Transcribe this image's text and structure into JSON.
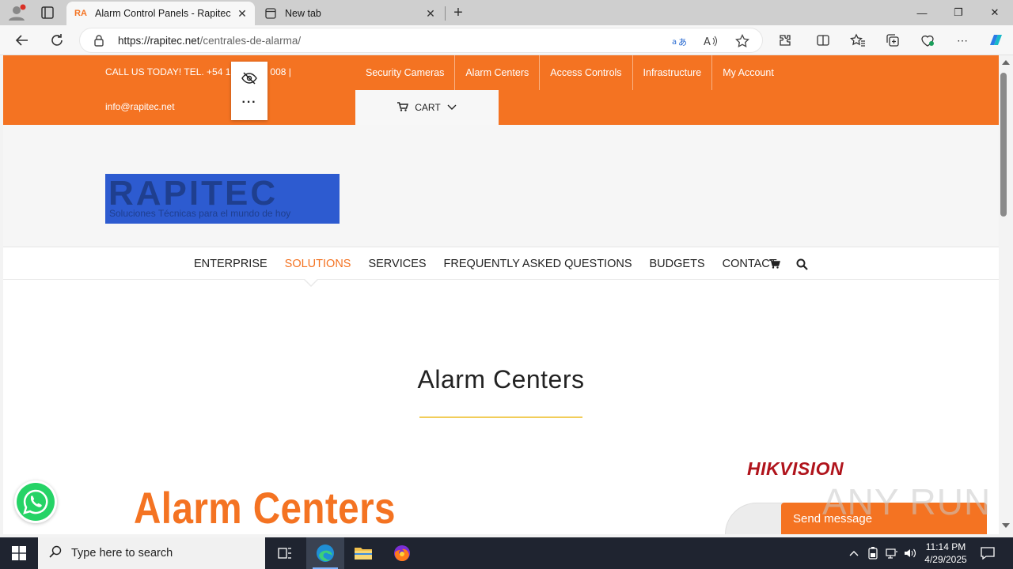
{
  "browser": {
    "tabs": [
      {
        "title": "Alarm Control Panels - Rapitec",
        "favicon_text": "RA",
        "active": true
      },
      {
        "title": "New tab",
        "active": false
      }
    ],
    "url_host": "https://rapitec.net",
    "url_path": "/centrales-de-alarma/"
  },
  "site": {
    "topbar": {
      "contact_left": "CALL US TODAY! TEL. +54 1",
      "contact_right": "008  |",
      "email": "info@rapitec.net",
      "nav": [
        "Security Cameras",
        "Alarm Centers",
        "Access Controls",
        "Infrastructure",
        "My Account"
      ],
      "cart_label": "CART"
    },
    "logo": {
      "brand": "RAPITEC",
      "tagline": "Soluciones Técnicas para el mundo de hoy"
    },
    "main_nav": [
      "ENTERPRISE",
      "SOLUTIONS",
      "SERVICES",
      "FREQUENTLY ASKED QUESTIONS",
      "BUDGETS",
      "CONTACT"
    ],
    "page_title": "Alarm Centers",
    "banner_title": "Alarm Centers",
    "brand_badge": "HIKVISION",
    "send_message": "Send message",
    "watermark": "ANY RUN"
  },
  "taskbar": {
    "search_placeholder": "Type here to search",
    "time": "11:14 PM",
    "date": "4/29/2025"
  },
  "colors": {
    "accent_orange": "#f47322",
    "logo_blue": "#2d5bd0",
    "title_rule": "#f2cd5a",
    "taskbar": "#1f2430"
  }
}
